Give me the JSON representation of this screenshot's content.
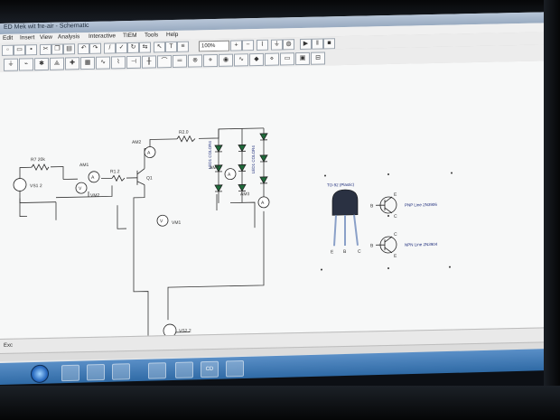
{
  "window": {
    "title": "ED Mek wit fre-air - Schematic"
  },
  "menu": {
    "items": [
      "Edit",
      "Insert",
      "View",
      "Analysis",
      "Interactive",
      "TIEM",
      "Tools",
      "Help"
    ]
  },
  "toolbar": {
    "zoom": "100%"
  },
  "schematic": {
    "labels": {
      "r7": "R7 20k",
      "r1": "R1.2",
      "r3": "R2.0",
      "vs1": "VS1 2",
      "am1": "AM1",
      "am2": "AM2",
      "am3": "AM3",
      "am4": "AM4",
      "vm1": "VM1",
      "vm2": "VM2",
      "vm3": "VM1",
      "vs2": "VS2.2",
      "q1": "Q1",
      "led_col1": "LED1 COLOR4",
      "led_col2": "LED1 COLOR4",
      "to92": "TO-92 (Plastic)",
      "pnp": "PNP  Line 2N3906",
      "npn": "NPN  Line 2N3904",
      "b1": "B",
      "e1": "E",
      "c1": "C",
      "b2": "B",
      "e2": "E",
      "c2": "C",
      "pin_e": "E",
      "pin_b": "B",
      "pin_c": "C"
    }
  },
  "sheet": {
    "tab": "Exc"
  },
  "taskbar": {
    "apps": [
      "",
      "",
      "",
      "",
      "",
      "CD",
      ""
    ]
  }
}
